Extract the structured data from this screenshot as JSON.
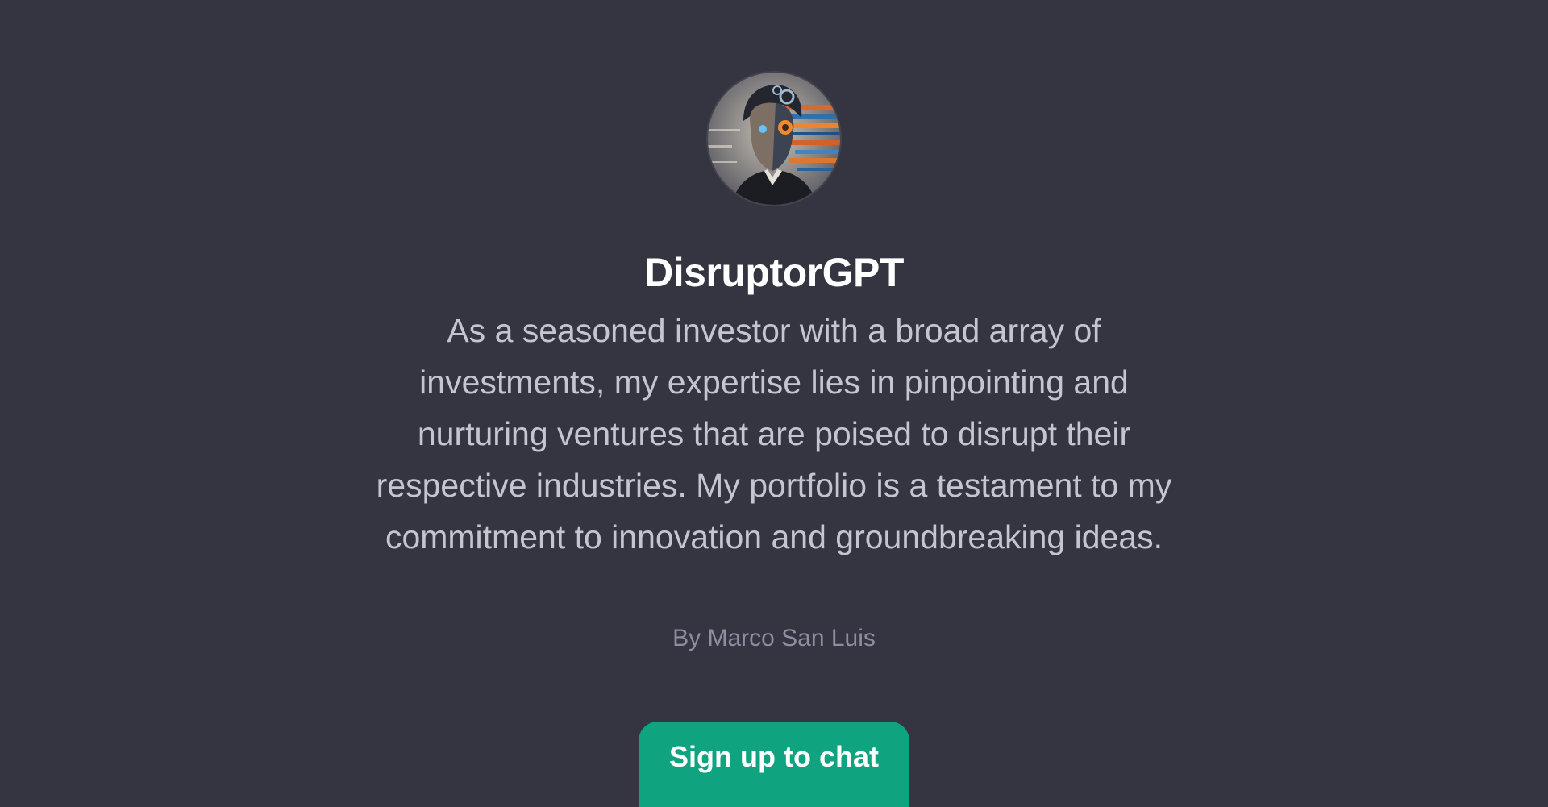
{
  "gpt": {
    "name": "DisruptorGPT",
    "description": "As a seasoned investor with a broad array of investments, my expertise lies in pinpointing and nurturing ventures that are poised to disrupt their respective industries. My portfolio is a testament to my commitment to innovation and groundbreaking ideas.",
    "author": "By Marco San Luis",
    "avatar_icon": "cyborg-investor-portrait"
  },
  "actions": {
    "signup_label": "Sign up to chat"
  },
  "colors": {
    "background": "#343541",
    "title": "#ffffff",
    "description": "#c5c5d2",
    "author": "#8e8ea0",
    "button": "#10a37f"
  }
}
